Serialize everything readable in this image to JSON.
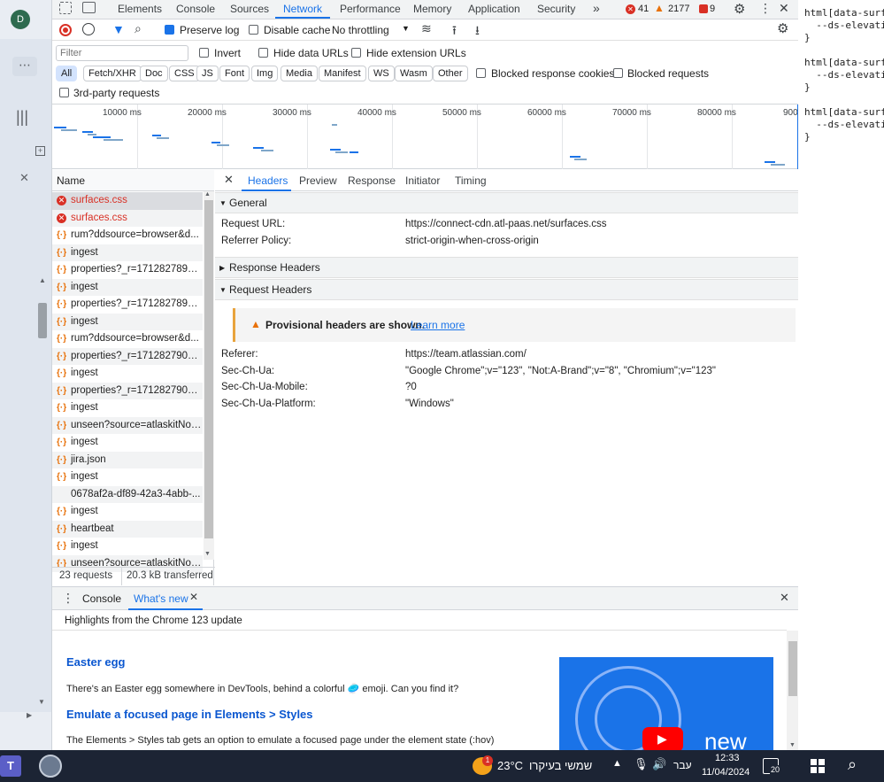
{
  "left": {
    "avatar_initial": "D"
  },
  "tabs": [
    "Elements",
    "Console",
    "Sources",
    "Network",
    "Performance",
    "Memory",
    "Application",
    "Security"
  ],
  "active_tab": "Network",
  "counters": {
    "errors": "41",
    "warnings": "2177",
    "issues": "9"
  },
  "toolbar": {
    "preserve_log": "Preserve log",
    "disable_cache": "Disable cache",
    "throttling": "No throttling"
  },
  "filter": {
    "placeholder": "Filter",
    "invert": "Invert",
    "hide_data": "Hide data URLs",
    "hide_ext": "Hide extension URLs",
    "types": [
      "All",
      "Fetch/XHR",
      "Doc",
      "CSS",
      "JS",
      "Font",
      "Img",
      "Media",
      "Manifest",
      "WS",
      "Wasm",
      "Other"
    ],
    "blocked_cookies": "Blocked response cookies",
    "blocked_requests": "Blocked requests",
    "third_party": "3rd-party requests"
  },
  "timeline": {
    "ticks": [
      "10000 ms",
      "20000 ms",
      "30000 ms",
      "40000 ms",
      "50000 ms",
      "60000 ms",
      "70000 ms",
      "80000 ms",
      "900"
    ]
  },
  "requests": {
    "header": "Name",
    "items": [
      {
        "name": "surfaces.css",
        "status": "error"
      },
      {
        "name": "surfaces.css",
        "status": "error"
      },
      {
        "name": "rum?ddsource=browser&d...",
        "status": "fetch"
      },
      {
        "name": "ingest",
        "status": "fetch"
      },
      {
        "name": "properties?_r=17128278923...",
        "status": "fetch"
      },
      {
        "name": "ingest",
        "status": "fetch"
      },
      {
        "name": "properties?_r=17128278957...",
        "status": "fetch"
      },
      {
        "name": "ingest",
        "status": "fetch"
      },
      {
        "name": "rum?ddsource=browser&d...",
        "status": "fetch"
      },
      {
        "name": "properties?_r=17128279027...",
        "status": "fetch"
      },
      {
        "name": "ingest",
        "status": "fetch"
      },
      {
        "name": "properties?_r=17128279097...",
        "status": "fetch"
      },
      {
        "name": "ingest",
        "status": "fetch"
      },
      {
        "name": "unseen?source=atlaskitNoti...",
        "status": "fetch"
      },
      {
        "name": "ingest",
        "status": "fetch"
      },
      {
        "name": "jira.json",
        "status": "fetch"
      },
      {
        "name": "ingest",
        "status": "fetch"
      },
      {
        "name": "0678af2a-df89-42a3-4abb-...",
        "status": "none"
      },
      {
        "name": "ingest",
        "status": "fetch"
      },
      {
        "name": "heartbeat",
        "status": "fetch"
      },
      {
        "name": "ingest",
        "status": "fetch"
      },
      {
        "name": "unseen?source=atlaskitNoti...",
        "status": "fetch"
      }
    ],
    "status_count": "23 requests",
    "status_transferred": "20.3 kB transferred"
  },
  "details": {
    "tabs": [
      "Headers",
      "Preview",
      "Response",
      "Initiator",
      "Timing"
    ],
    "general_title": "General",
    "request_url_label": "Request URL:",
    "request_url": "https://connect-cdn.atl-paas.net/surfaces.css",
    "referrer_policy_label": "Referrer Policy:",
    "referrer_policy": "strict-origin-when-cross-origin",
    "response_headers_title": "Response Headers",
    "request_headers_title": "Request Headers",
    "provisional": "Provisional headers are shown.",
    "learn_more": "Learn more",
    "headers": [
      {
        "k": "Referer:",
        "v": "https://team.atlassian.com/"
      },
      {
        "k": "Sec-Ch-Ua:",
        "v": "\"Google Chrome\";v=\"123\", \"Not:A-Brand\";v=\"8\", \"Chromium\";v=\"123\""
      },
      {
        "k": "Sec-Ch-Ua-Mobile:",
        "v": "?0"
      },
      {
        "k": "Sec-Ch-Ua-Platform:",
        "v": "\"Windows\""
      }
    ]
  },
  "drawer": {
    "tabs": [
      "Console",
      "What's new"
    ],
    "highlight": "Highlights from the Chrome 123 update",
    "h1": "Easter egg",
    "p1": "There's an Easter egg somewhere in DevTools, behind a colorful 🥏 emoji. Can you find it?",
    "h2": "Emulate a focused page in Elements > Styles",
    "p2": "The Elements > Styles tab gets an option to emulate a focused page under the element state (:hov)",
    "new_label": "new"
  },
  "code_lines": [
    "html[data-surf",
    "  --ds-elevati",
    "}",
    "",
    "html[data-surf",
    "  --ds-elevati",
    "}",
    "",
    "html[data-surf",
    "  --ds-elevati",
    "}"
  ],
  "taskbar": {
    "temp": "23°C",
    "weather": "שמשי בעיקרו",
    "lang": "עבר",
    "time": "12:33",
    "date": "11/04/2024",
    "notif": "20",
    "weather_badge": "1"
  }
}
